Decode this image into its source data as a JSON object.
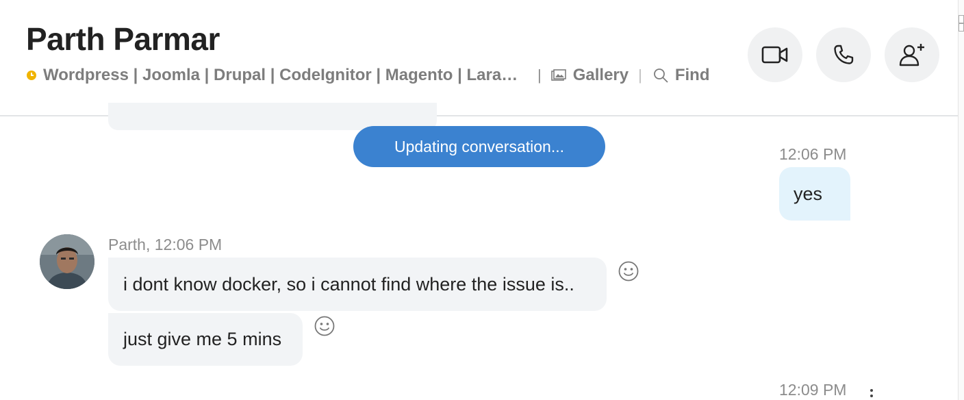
{
  "header": {
    "contact_name": "Parth Parmar",
    "mood": "Wordpress | Joomla | Drupal | CodeIgnitor | Magento | Laravel | Prestashop",
    "separator": "|",
    "gallery_label": "Gallery",
    "find_label": "Find",
    "buttons": {
      "video": "video-call-icon",
      "call": "phone-icon",
      "add_people": "add-person-icon"
    }
  },
  "conversation": {
    "status_banner": "Updating conversation...",
    "messages": [
      {
        "direction": "outgoing",
        "time": "12:06 PM",
        "text": "yes"
      },
      {
        "direction": "incoming",
        "sender_line": "Parth, 12:06 PM",
        "text": "i dont know docker, so i cannot find where the issue is.."
      },
      {
        "direction": "incoming",
        "text": "just give me 5 mins"
      },
      {
        "direction": "outgoing",
        "time": "12:09 PM"
      }
    ]
  },
  "colors": {
    "accent": "#3b82d0",
    "outgoing_bubble": "#e3f3fc",
    "incoming_bubble": "#f2f4f6",
    "mood_icon": "#f0b400"
  }
}
